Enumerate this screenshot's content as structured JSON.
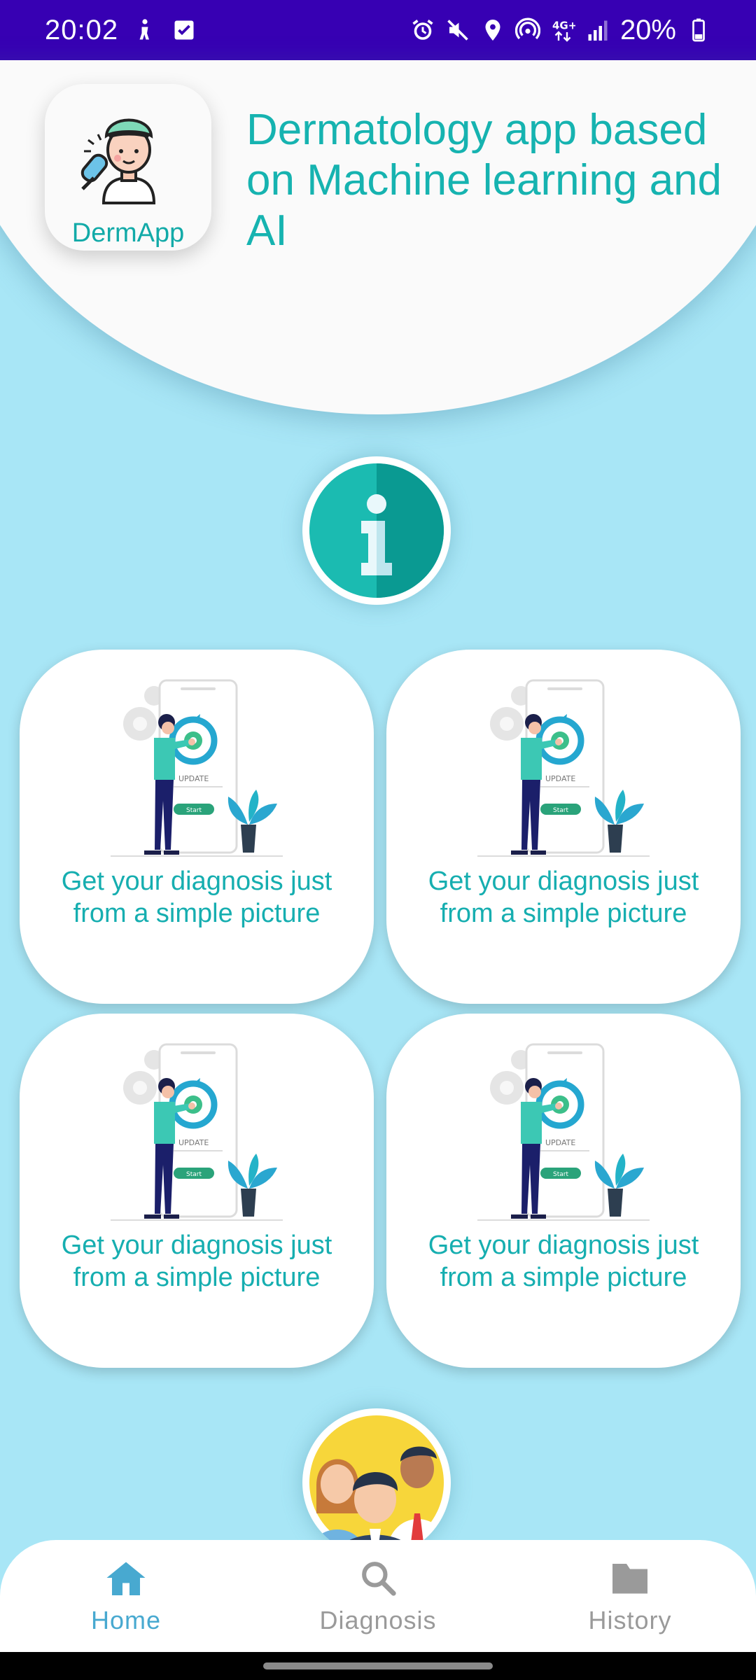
{
  "status_bar": {
    "time": "20:02",
    "battery_percent": "20%",
    "icons": [
      "person-walking-icon",
      "check-box-icon",
      "alarm-icon",
      "mute-icon",
      "location-icon",
      "hotspot-icon",
      "4g-plus-icon",
      "signal-icon",
      "battery-icon"
    ]
  },
  "header": {
    "logo_text": "DermApp",
    "title": "Dermatology app based on Machine learning and AI"
  },
  "info_button": {
    "icon": "info-icon"
  },
  "cards": [
    {
      "text": "Get your diagnosis just from a simple picture",
      "illustration": "phone-update-illustration"
    },
    {
      "text": "Get your diagnosis just from a simple picture",
      "illustration": "phone-update-illustration"
    },
    {
      "text": "Get your diagnosis just from a simple picture",
      "illustration": "phone-update-illustration"
    },
    {
      "text": "Get your diagnosis just from a simple picture",
      "illustration": "phone-update-illustration"
    }
  ],
  "illustration_labels": {
    "update": "UPDATE",
    "start": "Start"
  },
  "team_avatar": {
    "icon": "team-icon"
  },
  "bottom_nav": {
    "items": [
      {
        "label": "Home",
        "icon": "home-icon",
        "active": true
      },
      {
        "label": "Diagnosis",
        "icon": "search-icon",
        "active": false
      },
      {
        "label": "History",
        "icon": "folder-icon",
        "active": false
      }
    ]
  },
  "colors": {
    "status_bar": "#3700b3",
    "background": "#a8e6f6",
    "accent_teal": "#16b3b0",
    "nav_active": "#48a9d0",
    "nav_inactive": "#9a9a9a"
  }
}
